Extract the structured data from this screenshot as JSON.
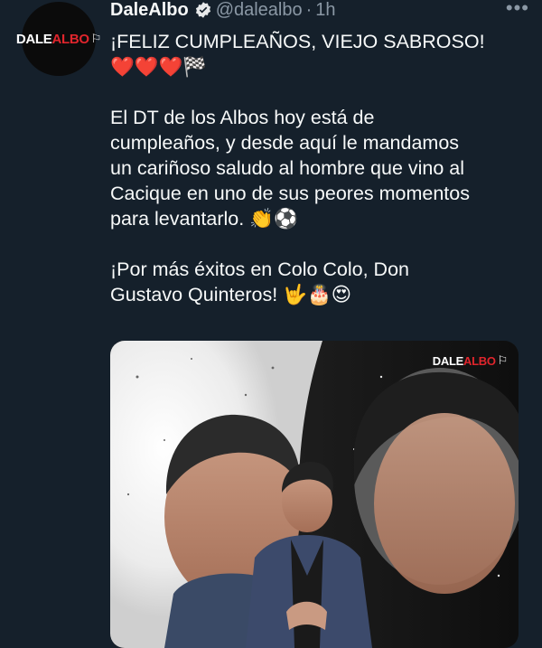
{
  "account": {
    "display_name": "DaleAlbo",
    "handle": "@dalealbo",
    "separator": "·",
    "time": "1h",
    "logo_left": "DALE",
    "logo_right": "ALBO",
    "logo_flag": "⚐"
  },
  "tweet": {
    "line1": "¡FELIZ CUMPLEAÑOS, VIEJO SABROSO!",
    "line2": "❤️❤️❤️🏁",
    "para2": [
      "El DT de los Albos hoy está de",
      "cumpleaños, y desde aquí le mandamos",
      "un cariñoso saludo al hombre que vino al",
      "Cacique en uno de sus peores momentos",
      "para levantarlo. 👏⚽"
    ],
    "para3": [
      "¡Por más éxitos en Colo Colo, Don",
      "Gustavo Quinteros! 🤟🎂😍"
    ]
  },
  "media": {
    "logo_left": "DALE",
    "logo_right": "ALBO",
    "logo_flag": "⚐"
  },
  "icons": {
    "verified": "verified-badge-icon",
    "more": "more-options-icon"
  },
  "colors": {
    "background": "#15202b",
    "text": "#f7f9f9",
    "muted": "#8b98a5",
    "brand_red": "#e0252c"
  }
}
